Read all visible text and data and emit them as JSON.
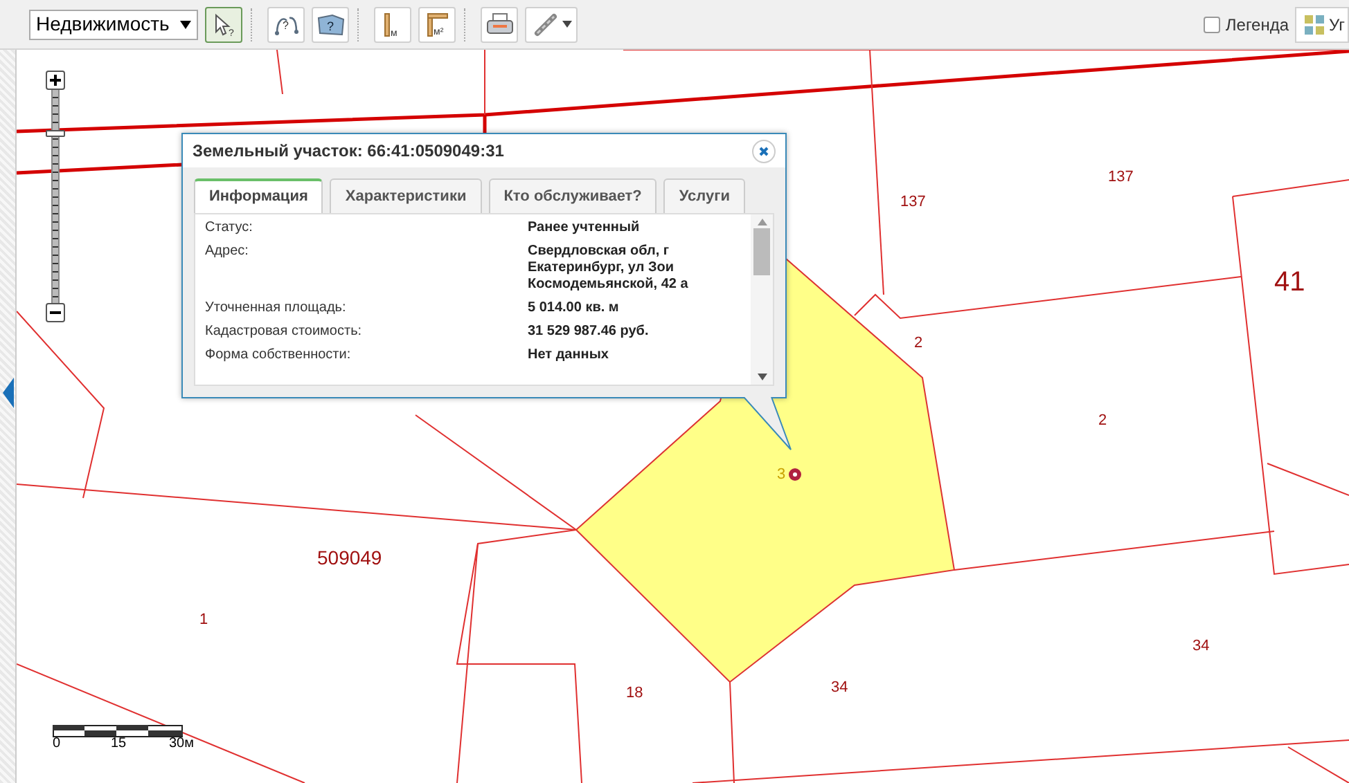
{
  "toolbar": {
    "layer_select": {
      "value": "Недвижимость"
    },
    "tools": [
      {
        "kind": "select-info",
        "glyph": "?",
        "selected": true
      },
      {
        "kind": "path-info",
        "glyph": "?",
        "selected": false
      },
      {
        "kind": "area-info",
        "glyph": "?",
        "selected": false
      },
      {
        "kind": "measure-length",
        "glyph": "м",
        "selected": false
      },
      {
        "kind": "measure-area",
        "glyph": "м²",
        "selected": false
      },
      {
        "kind": "print",
        "selected": false
      },
      {
        "kind": "link",
        "selected": false
      }
    ],
    "legend": {
      "label": "Легенда",
      "checked": false
    },
    "basemap_button": {
      "label": "Уг"
    }
  },
  "zoom": {
    "level": 0.81
  },
  "map": {
    "labels": [
      {
        "text": "137"
      },
      {
        "text": "137"
      },
      {
        "text": "41"
      },
      {
        "text": "2"
      },
      {
        "text": "2"
      },
      {
        "text": "3"
      },
      {
        "text": "509049"
      },
      {
        "text": "1"
      },
      {
        "text": "18"
      },
      {
        "text": "34"
      },
      {
        "text": "34"
      }
    ],
    "scale": {
      "ticks": [
        "0",
        "15",
        "30м"
      ]
    }
  },
  "popup": {
    "title": "Земельный участок: 66:41:0509049:31",
    "tabs": [
      {
        "label": "Информация",
        "selected": true
      },
      {
        "label": "Характеристики",
        "selected": false
      },
      {
        "label": "Кто обслуживает?",
        "selected": false
      },
      {
        "label": "Услуги",
        "selected": false
      }
    ],
    "rows": [
      {
        "label": "Статус:",
        "value": "Ранее учтенный"
      },
      {
        "label": "Адрес:",
        "value": "Свердловская обл, г Екатеринбург, ул Зои Космодемьянской, 42 а"
      },
      {
        "label": "Уточненная площадь:",
        "value": "5 014.00 кв. м"
      },
      {
        "label": "Кадастровая стоимость:",
        "value": "31 529 987.46 руб."
      },
      {
        "label": "Форма собственности:",
        "value": "Нет данных"
      }
    ]
  }
}
